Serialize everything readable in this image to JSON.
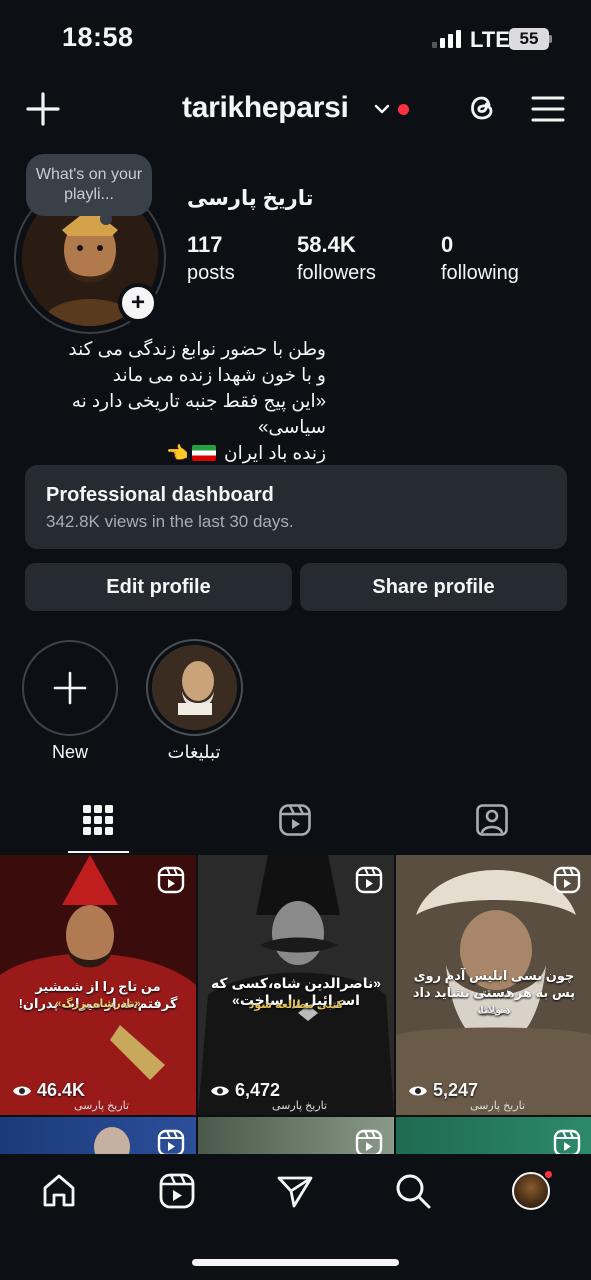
{
  "status_bar": {
    "time": "18:58",
    "network": "LTE",
    "battery": "55"
  },
  "header": {
    "username": "tarikheparsi"
  },
  "profile": {
    "note": "What's on your playli...",
    "display_name": "تاریخ پارسی",
    "stats": [
      {
        "value": "117",
        "label": "posts"
      },
      {
        "value": "58.4K",
        "label": "followers"
      },
      {
        "value": "0",
        "label": "following"
      }
    ],
    "bio_lines": [
      "وطن با حضور نوابغ زندگی می کند",
      "و با خون شهدا زنده می ماند",
      "«این پیج فقط جنبه تاریخی دارد نه سیاسی»",
      "زنده باد ایران"
    ]
  },
  "dashboard": {
    "title": "Professional dashboard",
    "subtitle": "342.8K views in the last 30 days."
  },
  "buttons": {
    "edit": "Edit profile",
    "share": "Share profile"
  },
  "highlights": [
    {
      "label": "New"
    },
    {
      "label": "تبلیغات"
    }
  ],
  "grid": [
    {
      "views": "46.4K",
      "caption": "من تاج را از شمشیر گرفتم،نه از میراث پدران!",
      "caption2": "«نادرشاه بزرگ»",
      "handle": "تاریخ پارسی"
    },
    {
      "views": "6,472",
      "caption": "«ناصرالدین شاه،کسی که اسرائیل را ساخت»",
      "caption2": "کتبی مطالعه شود",
      "handle": "تاریخ پارسی"
    },
    {
      "views": "5,247",
      "caption": "چون بسی ابلیس آدم روی هست،",
      "caption2": "پس به هر دستی نشاید داد دست",
      "caption3": "مولانا",
      "handle": "تاریخ پارسی"
    }
  ],
  "colors": {
    "background": "#0c1014",
    "surface": "#262a31",
    "notification": "#ff3040"
  }
}
